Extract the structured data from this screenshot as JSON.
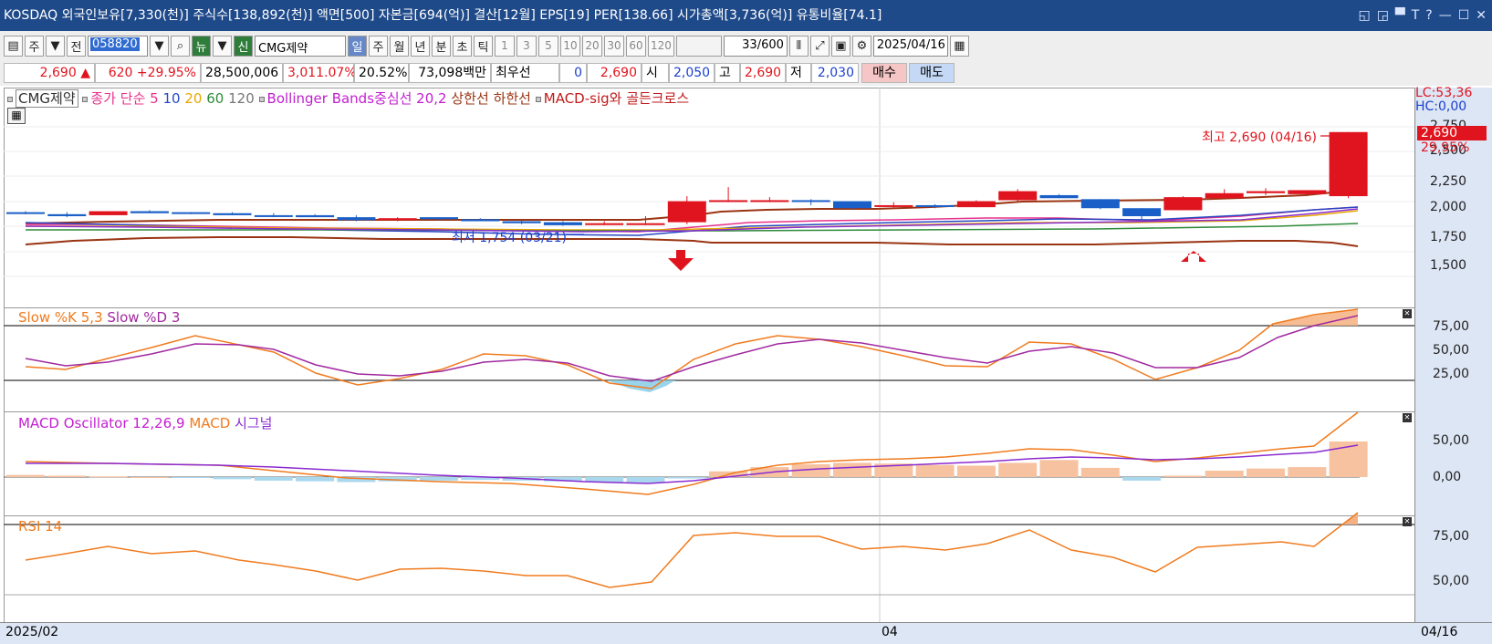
{
  "title": "KOSDAQ 외국인보유[7,330(천)] 주식수[138,892(천)] 액면[500] 자본금[694(억)] 결산[12월] EPS[19] PER[138.66] 시가총액[3,736(억)] 유통비율[74.1]",
  "window_controls": [
    "◱",
    "◲",
    "▀",
    "T",
    "?",
    "—",
    "☐",
    "✕"
  ],
  "toolbar": {
    "period_sel": "주",
    "prev": "전",
    "code": "058820",
    "news": "뉴",
    "new": "신",
    "stock_name": "CMG제약",
    "periods": [
      "일",
      "주",
      "월",
      "년",
      "분",
      "초",
      "틱"
    ],
    "minutes": [
      "1",
      "3",
      "5",
      "10",
      "20",
      "30",
      "60",
      "120"
    ],
    "count": "33",
    "count_max": "/600",
    "date": "2025/04/16"
  },
  "info": {
    "price": "2,690",
    "change": "620",
    "change_pct": "+29.95%",
    "volume": "28,500,006",
    "vol_ratio": "3,011.07%",
    "turnover": "20.52%",
    "amount": "73,098백만",
    "best_offer_label": "최우선",
    "best_offer_qty": "0",
    "best_offer_price": "2,690",
    "open_label": "시",
    "open": "2,050",
    "high_label": "고",
    "high": "2,690",
    "low_label": "저",
    "low": "2,030",
    "buy": "매수",
    "sell": "매도"
  },
  "legend": {
    "stock": "CMG제약",
    "ma_label": "종가 단순 5",
    "ma10": "10",
    "ma20": "20",
    "ma60": "60",
    "ma120": "120",
    "bb": "Bollinger Bands중심선 20,2",
    "upper": "상한선",
    "lower": "하한선",
    "macd_sig": "MACD-sig와 골든크로스"
  },
  "price_axis": {
    "lc": "LC:53,36",
    "hc": "HC:0,00",
    "ticks": [
      "2,750",
      "2,500",
      "2,250",
      "2,000",
      "1,750",
      "1,500"
    ],
    "cur_price": "2,690",
    "cur_pct": "29,95%"
  },
  "annotations": {
    "high": "최고 2,690 (04/16)",
    "low": "최저 1,754 (03/21)"
  },
  "stoch": {
    "k_label": "Slow %K 5,3",
    "d_label": "Slow %D 3",
    "ticks": [
      "75,00",
      "50,00",
      "25,00"
    ]
  },
  "macd": {
    "osc_label": "MACD Oscillator 12,26,9",
    "macd_label": "MACD",
    "sig_label": "시그널",
    "ticks": [
      "50,00",
      "0,00"
    ]
  },
  "rsi": {
    "label": "RSI 14",
    "ticks": [
      "75,00",
      "50,00"
    ]
  },
  "dates": {
    "start": "2025/02",
    "mid": "04",
    "end": "04/16"
  },
  "colors": {
    "up": "#e0141e",
    "down": "#1a5fc8",
    "band": "#9a3412",
    "title_bg": "#1f4a8a"
  }
}
